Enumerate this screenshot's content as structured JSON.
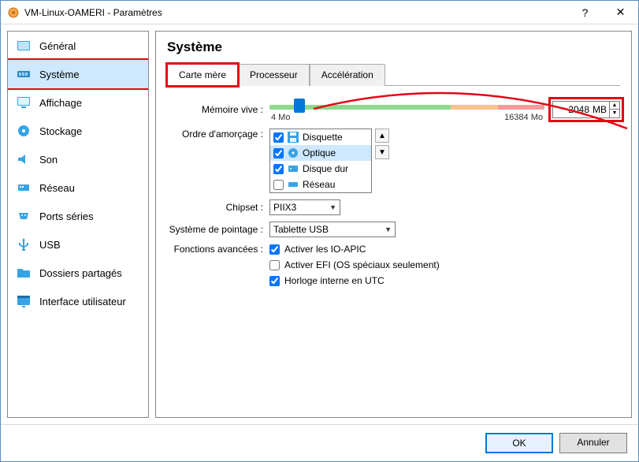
{
  "window": {
    "title": "VM-Linux-OAMERI - Paramètres"
  },
  "sidebar": {
    "items": [
      {
        "label": "Général"
      },
      {
        "label": "Système"
      },
      {
        "label": "Affichage"
      },
      {
        "label": "Stockage"
      },
      {
        "label": "Son"
      },
      {
        "label": "Réseau"
      },
      {
        "label": "Ports séries"
      },
      {
        "label": "USB"
      },
      {
        "label": "Dossiers partagés"
      },
      {
        "label": "Interface utilisateur"
      }
    ],
    "selected_index": 1
  },
  "content": {
    "heading": "Système",
    "tabs": [
      {
        "label": "Carte mère"
      },
      {
        "label": "Processeur"
      },
      {
        "label": "Accélération"
      }
    ],
    "active_tab_index": 0,
    "memory": {
      "label": "Mémoire vive :",
      "value": "2048",
      "unit": "MB",
      "min_label": "4 Mo",
      "max_label": "16384 Mo"
    },
    "boot": {
      "label": "Ordre d'amorçage :",
      "items": [
        {
          "label": "Disquette",
          "checked": true,
          "icon": "floppy"
        },
        {
          "label": "Optique",
          "checked": true,
          "icon": "optical",
          "selected": true
        },
        {
          "label": "Disque dur",
          "checked": true,
          "icon": "hdd"
        },
        {
          "label": "Réseau",
          "checked": false,
          "icon": "net"
        }
      ]
    },
    "chipset": {
      "label": "Chipset :",
      "value": "PIIX3"
    },
    "pointing": {
      "label": "Système de pointage :",
      "value": "Tablette USB"
    },
    "advanced": {
      "label": "Fonctions avancées :",
      "items": [
        {
          "label": "Activer les IO-APIC",
          "checked": true
        },
        {
          "label": "Activer EFI (OS spéciaux seulement)",
          "checked": false
        },
        {
          "label": "Horloge interne en UTC",
          "checked": true
        }
      ]
    }
  },
  "footer": {
    "ok": "OK",
    "cancel": "Annuler"
  }
}
